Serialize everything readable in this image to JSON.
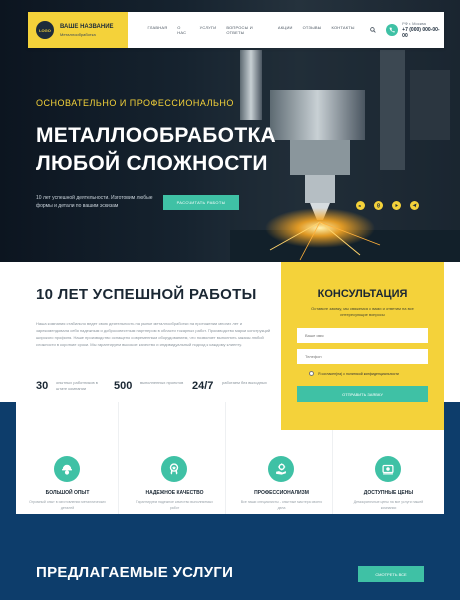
{
  "header": {
    "logo_text": "LOGO",
    "brand_name": "ВАШЕ НАЗВАНИЕ",
    "brand_sub": "Металлообработка",
    "nav": [
      "ГЛАВНАЯ",
      "О НАС",
      "УСЛУГИ",
      "ВОПРОСЫ И ОТВЕТЫ",
      "АКЦИИ",
      "ОТЗЫВЫ",
      "КОНТАКТЫ"
    ],
    "city": "РФ г. Москва",
    "phone": "+7 (000) 000-00-00"
  },
  "hero": {
    "tagline": "ОСНОВАТЕЛЬНО И ПРОФЕССИОНАЛЬНО",
    "title": "МЕТАЛЛООБРАБОТКА ЛЮБОЙ СЛОЖНОСТИ",
    "description": "10 лет успешной деятельности. Изготовим любые формы и детали по вашим эскизам",
    "button": "РАССЧИТАТЬ РАБОТЫ",
    "social": [
      "vk",
      "ok",
      "yt",
      "tg"
    ]
  },
  "about": {
    "title": "10 ЛЕТ УСПЕШНОЙ РАБОТЫ",
    "text": "Наша компания стабильно ведет свою деятельность на рынке металлообработки на протяжении многих лет и зарекомендовала себя надежным и добросовестным партнером в области токарных работ. Производство марки конструкций широкого профиля. Наше производство оснащено современным оборудованием, что позволяет выполнять заказы любой сложности в короткие сроки. Мы гарантируем высокое качество и индивидуальный подход к каждому клиенту.",
    "stats": [
      {
        "value": "30",
        "label": "опытных работников в штате компании"
      },
      {
        "value": "500",
        "label": "выполненных проектов"
      },
      {
        "value": "24/7",
        "label": "работаем без выходных"
      }
    ]
  },
  "consult": {
    "title": "КОНСУЛЬТАЦИЯ",
    "text": "Оставьте заявку, мы свяжемся с вами и ответим на все интересующие вопросы",
    "name_placeholder": "Ваше имя",
    "phone_placeholder": "Телефон",
    "consent": "Я согласен(на) с политикой конфиденциальности",
    "button": "ОТПРАВИТЬ ЗАЯВКУ"
  },
  "features": [
    {
      "icon": "worker-icon",
      "title": "БОЛЬШОЙ ОПЫТ",
      "text": "Огромный опыт в изготовлении металлических деталей"
    },
    {
      "icon": "medal-icon",
      "title": "НАДЕЖНОЕ КАЧЕСТВО",
      "text": "Гарантируем надежное качество выполняемых работ"
    },
    {
      "icon": "gear-hand-icon",
      "title": "ПРОФЕССИОНАЛИЗМ",
      "text": "Все наши специалисты - опытные мастера своего дела"
    },
    {
      "icon": "price-icon",
      "title": "ДОСТУПНЫЕ ЦЕНЫ",
      "text": "Демократичные цены на все услуги нашей компании"
    }
  ],
  "services": {
    "title": "ПРЕДЛАГАЕМЫЕ УСЛУГИ",
    "button": "СМОТРЕТЬ ВСЕ"
  },
  "colors": {
    "accent": "#3fc1a5",
    "brand_yellow": "#f4d23a",
    "navy": "#0d3d6b"
  }
}
